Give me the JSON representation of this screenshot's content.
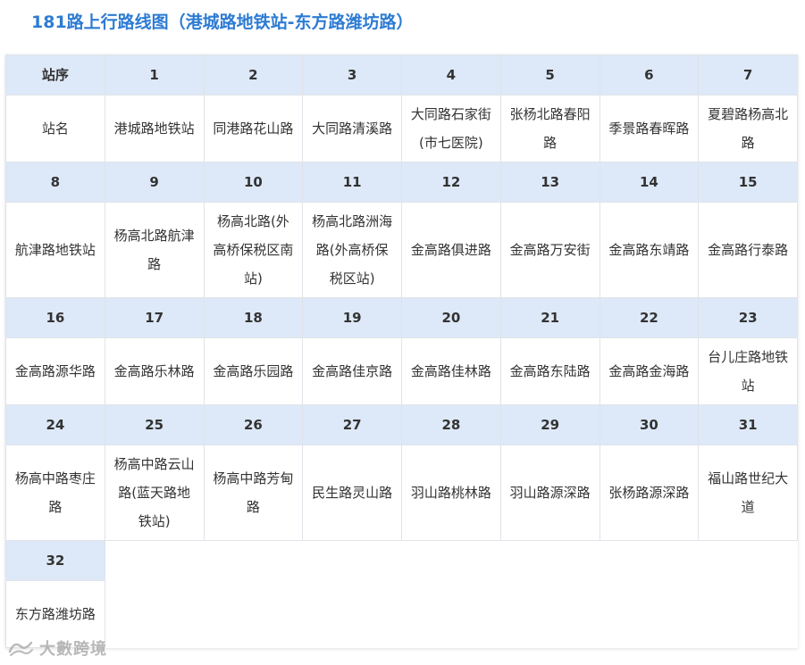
{
  "title": "181路上行路线图（港城路地铁站-东方路潍坊路）",
  "table": {
    "header_label": "站序",
    "name_label": "站名",
    "row1": {
      "numbers": [
        "1",
        "2",
        "3",
        "4",
        "5",
        "6",
        "7"
      ],
      "names": [
        "港城路地铁站",
        "同港路花山路",
        "大同路清溪路",
        "大同路石家街(市七医院)",
        "张杨北路春阳路",
        "季景路春晖路",
        "夏碧路杨高北路"
      ]
    },
    "row2": {
      "numbers": [
        "8",
        "9",
        "10",
        "11",
        "12",
        "13",
        "14",
        "15"
      ],
      "names": [
        "航津路地铁站",
        "杨高北路航津路",
        "杨高北路(外高桥保税区南站)",
        "杨高北路洲海路(外高桥保税区站)",
        "金高路俱进路",
        "金高路万安街",
        "金高路东靖路",
        "金高路行泰路"
      ]
    },
    "row3": {
      "numbers": [
        "16",
        "17",
        "18",
        "19",
        "20",
        "21",
        "22",
        "23"
      ],
      "names": [
        "金高路源华路",
        "金高路乐林路",
        "金高路乐园路",
        "金高路佳京路",
        "金高路佳林路",
        "金高路东陆路",
        "金高路金海路",
        "台儿庄路地铁站"
      ]
    },
    "row4": {
      "numbers": [
        "24",
        "25",
        "26",
        "27",
        "28",
        "29",
        "30",
        "31"
      ],
      "names": [
        "杨高中路枣庄路",
        "杨高中路云山路(蓝天路地铁站)",
        "杨高中路芳甸路",
        "民生路灵山路",
        "羽山路桃林路",
        "羽山路源深路",
        "张杨路源深路",
        "福山路世纪大道"
      ]
    },
    "row5": {
      "numbers": [
        "32"
      ],
      "names": [
        "东方路潍坊路"
      ]
    }
  },
  "watermark": {
    "text": "大數跨境"
  }
}
